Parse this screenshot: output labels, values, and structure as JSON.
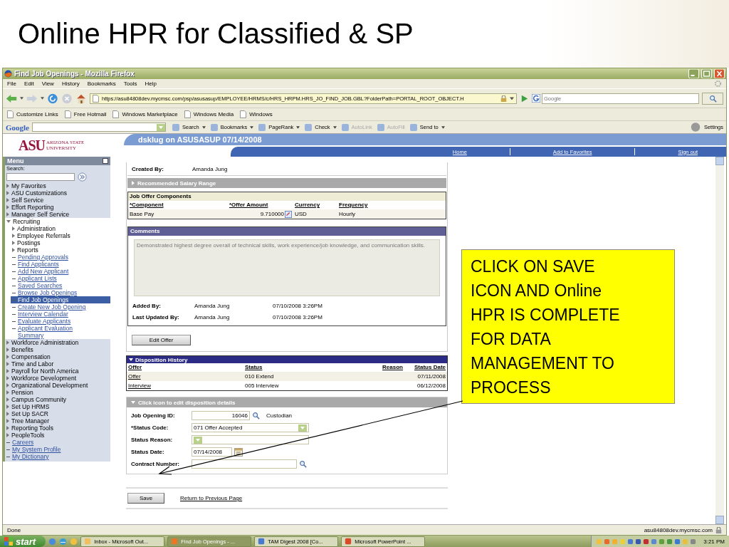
{
  "slide": {
    "title": "Online HPR for Classified & SP"
  },
  "window": {
    "title": "Find Job Openings - Mozilla Firefox"
  },
  "menu_bar": [
    "File",
    "Edit",
    "View",
    "History",
    "Bookmarks",
    "Tools",
    "Help"
  ],
  "address": {
    "url": "https://asu84808dev.mycmsc.com/psp/asusasup/EMPLOYEE/HRMS/c/HRS_HRPM.HRS_JO_FIND_JOB.GBL?FolderPath=PORTAL_ROOT_OBJECT.H"
  },
  "search_box": {
    "placeholder": "Google"
  },
  "bookmarks": [
    "Customize Links",
    "Free Hotmail",
    "Windows Marketplace",
    "Windows Media",
    "Windows"
  ],
  "google_toolbar": {
    "logo": "Google",
    "items": [
      {
        "label": "Search",
        "dropdown": true,
        "disabled": false
      },
      {
        "label": "Bookmarks",
        "dropdown": true,
        "disabled": false
      },
      {
        "label": "PageRank",
        "dropdown": true,
        "disabled": false
      },
      {
        "label": "Check",
        "dropdown": true,
        "disabled": false
      },
      {
        "label": "AutoLink",
        "dropdown": false,
        "disabled": true
      },
      {
        "label": "AutoFill",
        "dropdown": false,
        "disabled": true
      },
      {
        "label": "Send to",
        "dropdown": true,
        "disabled": false
      }
    ],
    "settings": "Settings"
  },
  "header": {
    "logo_mark": "ASU",
    "logo_line1": "ARIZONA STATE",
    "logo_line2": "UNIVERSITY",
    "banner": "dsklug on ASUSASUP 07/14/2008",
    "links": [
      "Home",
      "Add to Favorites",
      "Sign out"
    ]
  },
  "menu": {
    "title": "Menu",
    "search_label": "Search:",
    "items": [
      {
        "label": "My Favorites",
        "kind": "folder",
        "expanded": false
      },
      {
        "label": "ASU Customizations",
        "kind": "folder",
        "expanded": false
      },
      {
        "label": "Self Service",
        "kind": "folder",
        "expanded": false
      },
      {
        "label": "Effort Reporting",
        "kind": "folder",
        "expanded": false
      },
      {
        "label": "Manager Self Service",
        "kind": "folder",
        "expanded": false
      },
      {
        "label": "Recruiting",
        "kind": "folder",
        "expanded": true,
        "children": [
          {
            "label": "Administration",
            "kind": "folder",
            "expanded": false
          },
          {
            "label": "Employee Referrals",
            "kind": "folder",
            "expanded": false
          },
          {
            "label": "Postings",
            "kind": "folder",
            "expanded": false
          },
          {
            "label": "Reports",
            "kind": "folder",
            "expanded": false
          },
          {
            "label": "Pending Approvals",
            "kind": "link",
            "selected": false
          },
          {
            "label": "Find Applicants",
            "kind": "link",
            "selected": false
          },
          {
            "label": "Add New Applicant",
            "kind": "link",
            "selected": false
          },
          {
            "label": "Applicant Lists",
            "kind": "link",
            "selected": false
          },
          {
            "label": "Saved Searches",
            "kind": "link",
            "selected": false
          },
          {
            "label": "Browse Job Openings",
            "kind": "link",
            "selected": false
          },
          {
            "label": "Find Job Openings",
            "kind": "link",
            "selected": true
          },
          {
            "label": "Create New Job Opening",
            "kind": "link",
            "selected": false
          },
          {
            "label": "Interview Calendar",
            "kind": "link",
            "selected": false
          },
          {
            "label": "Evaluate Applicants",
            "kind": "link",
            "selected": false
          },
          {
            "label": "Applicant Evaluation Summary",
            "kind": "link",
            "selected": false
          }
        ]
      },
      {
        "label": "Workforce Administration",
        "kind": "folder",
        "expanded": false
      },
      {
        "label": "Benefits",
        "kind": "folder",
        "expanded": false
      },
      {
        "label": "Compensation",
        "kind": "folder",
        "expanded": false
      },
      {
        "label": "Time and Labor",
        "kind": "folder",
        "expanded": false
      },
      {
        "label": "Payroll for North America",
        "kind": "folder",
        "expanded": false
      },
      {
        "label": "Workforce Development",
        "kind": "folder",
        "expanded": false
      },
      {
        "label": "Organizational Development",
        "kind": "folder",
        "expanded": false
      },
      {
        "label": "Pension",
        "kind": "folder",
        "expanded": false
      },
      {
        "label": "Campus Community",
        "kind": "folder",
        "expanded": false
      },
      {
        "label": "Set Up HRMS",
        "kind": "folder",
        "expanded": false
      },
      {
        "label": "Set Up SACR",
        "kind": "folder",
        "expanded": false
      },
      {
        "label": "Tree Manager",
        "kind": "folder",
        "expanded": false
      },
      {
        "label": "Reporting Tools",
        "kind": "folder",
        "expanded": false
      },
      {
        "label": "PeopleTools",
        "kind": "folder",
        "expanded": false
      },
      {
        "label": "Careers",
        "kind": "link",
        "selected": false
      },
      {
        "label": "My System Profile",
        "kind": "link",
        "selected": false
      },
      {
        "label": "My Dictionary",
        "kind": "link",
        "selected": false
      }
    ]
  },
  "created_by": {
    "label": "Created By:",
    "value": "Amanda Jung"
  },
  "salary_range": {
    "title": "Recommended Salary Range",
    "expanded": false
  },
  "offer_components": {
    "title": "Job Offer Components",
    "columns": [
      "*Component",
      "*Offer Amount",
      "Currency",
      "Frequency"
    ],
    "rows": [
      {
        "component": "Base Pay",
        "amount": "9.710000",
        "currency": "USD",
        "frequency": "Hourly"
      }
    ]
  },
  "comments": {
    "title": "Comments",
    "text": "Demonstrated highest degree overall of technical skills, work experience/job knowledge, and communication skills.",
    "entries": [
      {
        "label": "Added By:",
        "name": "Amanda Jung",
        "time": "07/10/2008  3:26PM"
      },
      {
        "label": "Last Updated By:",
        "name": "Amanda Jung",
        "time": "07/10/2008  3:26PM"
      }
    ]
  },
  "edit_offer": "Edit Offer",
  "disposition_history": {
    "title": "Disposition History",
    "expanded": true,
    "columns": [
      "Offer",
      "Status",
      "Reason",
      "Status Date"
    ],
    "rows": [
      {
        "offer": "Offer",
        "status": "010 Extend",
        "date": "07/11/2008"
      },
      {
        "offer": "Interview",
        "status": "005 Interview",
        "date": "06/12/2008"
      }
    ]
  },
  "disposition_details": {
    "title": "Click icon to edit disposition details",
    "expanded": true,
    "fields": [
      {
        "label": "Job Opening ID:",
        "kind": "lookup",
        "value": "16046",
        "note": "Custodian"
      },
      {
        "label": "*Status Code:",
        "kind": "select",
        "value": "071 Offer Accepted"
      },
      {
        "label": "Status Reason:",
        "kind": "select"
      },
      {
        "label": "Status Date:",
        "kind": "date",
        "value": "07/14/2008"
      },
      {
        "label": "Contract Number:",
        "kind": "lookup"
      }
    ]
  },
  "actions": {
    "save": "Save",
    "return_link": "Return to Previous Page"
  },
  "callout": {
    "text": "CLICK ON SAVE ICON AND Online HPR IS COMPLETE FOR DATA MANAGEMENT TO PROCESS"
  },
  "status_bar": {
    "text": "Done",
    "host": "asu84808dev.mycmsc.com"
  },
  "taskbar": {
    "start": "start",
    "tasks": [
      {
        "label": "Inbox - Microsoft Out...",
        "selected": false
      },
      {
        "label": "Find Job Openings - ...",
        "selected": true
      },
      {
        "label": "TAM Digest 2008 [Co...",
        "selected": false
      },
      {
        "label": "Microsoft PowerPoint ...",
        "selected": false
      }
    ],
    "clock": "3:21 PM"
  }
}
